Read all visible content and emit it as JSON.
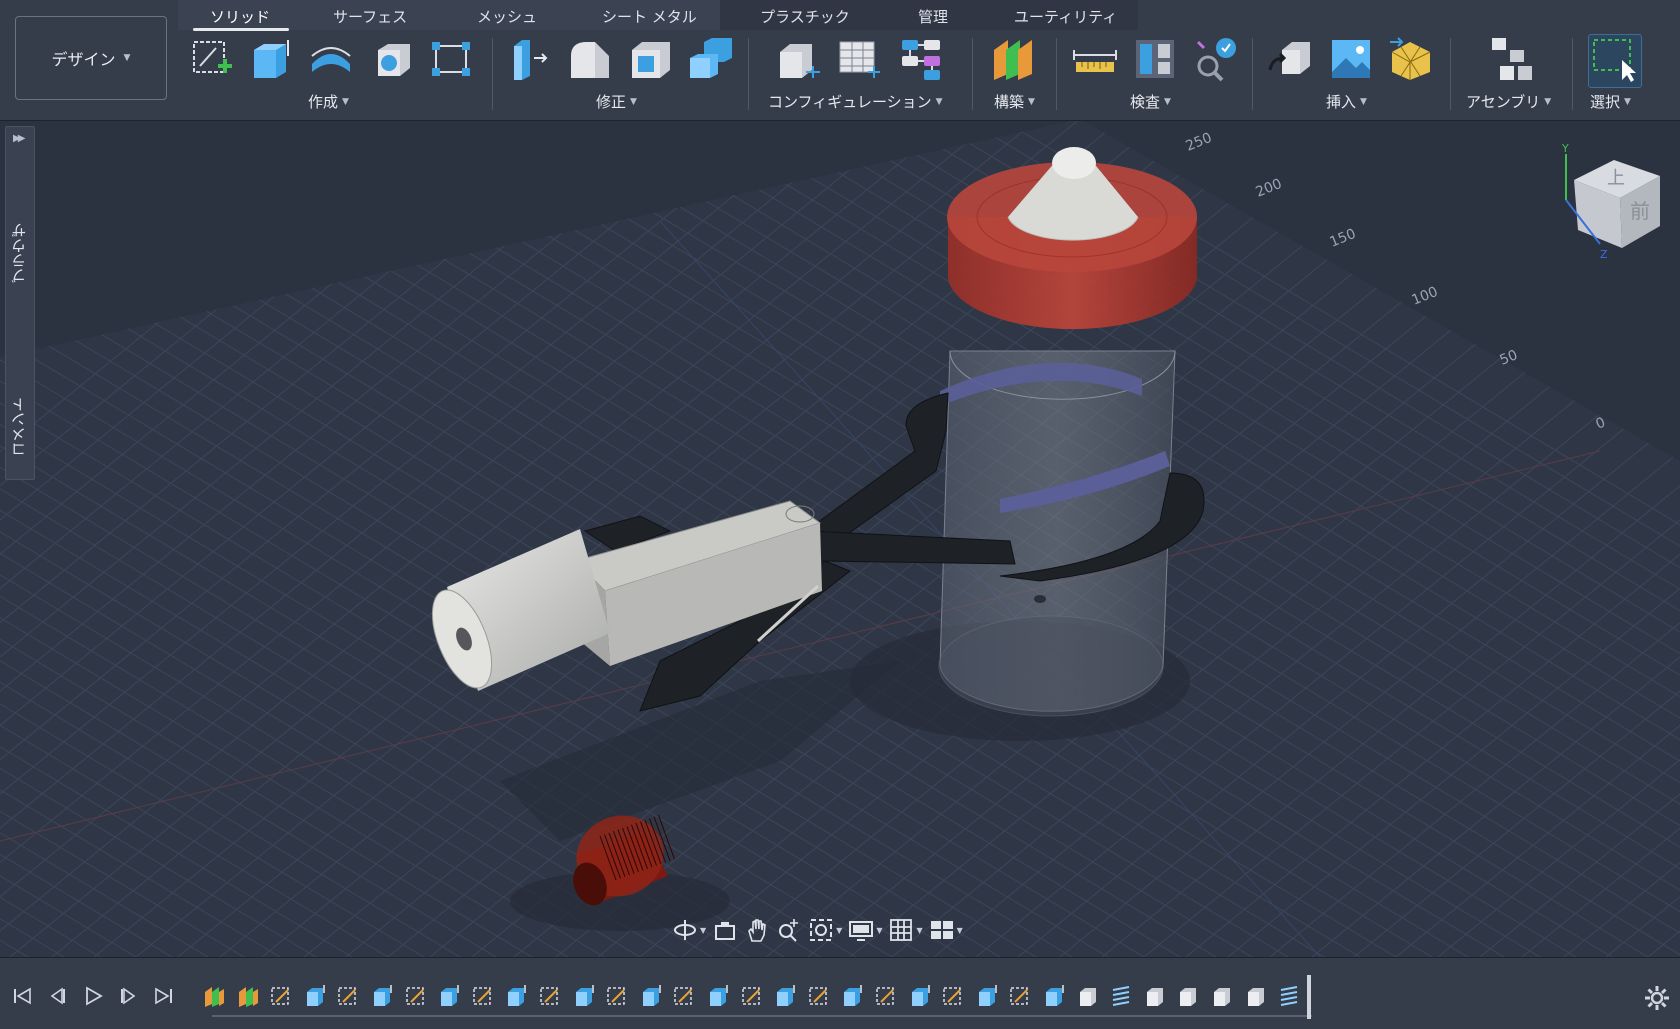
{
  "toolbar": {
    "workspace": "デザイン",
    "tabs": [
      {
        "label": "ソリッド",
        "active": true
      },
      {
        "label": "サーフェス"
      },
      {
        "label": "メッシュ"
      },
      {
        "label": "シート メタル"
      },
      {
        "label": "プラスチック"
      },
      {
        "label": "管理"
      },
      {
        "label": "ユーティリティ"
      }
    ],
    "groups": {
      "create": "作成",
      "modify": "修正",
      "configuration": "コンフィギュレーション",
      "construct": "構築",
      "inspect": "検査",
      "insert": "挿入",
      "assemble": "アセンブリ",
      "select": "選択"
    },
    "tool_icons": {
      "create": [
        "create-sketch-icon",
        "extrude-icon",
        "revolve-icon",
        "hole-icon",
        "pattern-icon"
      ],
      "modify": [
        "press-pull-icon",
        "fillet-icon",
        "shell-icon",
        "combine-icon"
      ],
      "configuration": [
        "configure-model-icon",
        "configuration-table-icon",
        "theme-table-icon"
      ],
      "construct": [
        "offset-plane-icon"
      ],
      "inspect": [
        "measure-icon",
        "section-analysis-icon",
        "interference-icon"
      ],
      "insert": [
        "insert-derive-icon",
        "insert-canvas-icon",
        "insert-mesh-icon"
      ],
      "assemble": [
        "new-component-icon"
      ],
      "select": [
        "window-select-icon"
      ]
    }
  },
  "side_panel": {
    "browser": "ブラウザ",
    "comments": "コメント"
  },
  "viewport": {
    "ruler_labels": [
      "250",
      "200",
      "150",
      "100",
      "50",
      "0"
    ],
    "view_cube": {
      "top": "上",
      "front": "前",
      "axis_y": "Y",
      "axis_z": "Z"
    },
    "colors": {
      "background": "#2b3240",
      "grid": "#3c4556",
      "cap": "#b23a2e",
      "coil": "#8a1a10",
      "arm": "#1e2126"
    }
  },
  "nav_bar": [
    "orbit-icon",
    "look-at-icon",
    "pan-icon",
    "zoom-icon",
    "fit-icon",
    "display-settings-icon",
    "grid-settings-icon",
    "viewports-icon"
  ],
  "timeline": {
    "controls": [
      "go-to-start-icon",
      "step-back-icon",
      "play-icon",
      "step-forward-icon",
      "go-to-end-icon"
    ],
    "features": [
      "plane",
      "plane",
      "sketch",
      "extrude",
      "sketch",
      "extrude",
      "sketch",
      "extrude",
      "sketch",
      "extrude",
      "sketch",
      "extrude",
      "sketch",
      "extrude",
      "sketch",
      "extrude",
      "sketch",
      "extrude",
      "sketch",
      "extrude",
      "sketch",
      "extrude",
      "sketch",
      "extrude",
      "sketch",
      "extrude",
      "body",
      "coil",
      "body",
      "body",
      "body",
      "body",
      "coil"
    ]
  }
}
